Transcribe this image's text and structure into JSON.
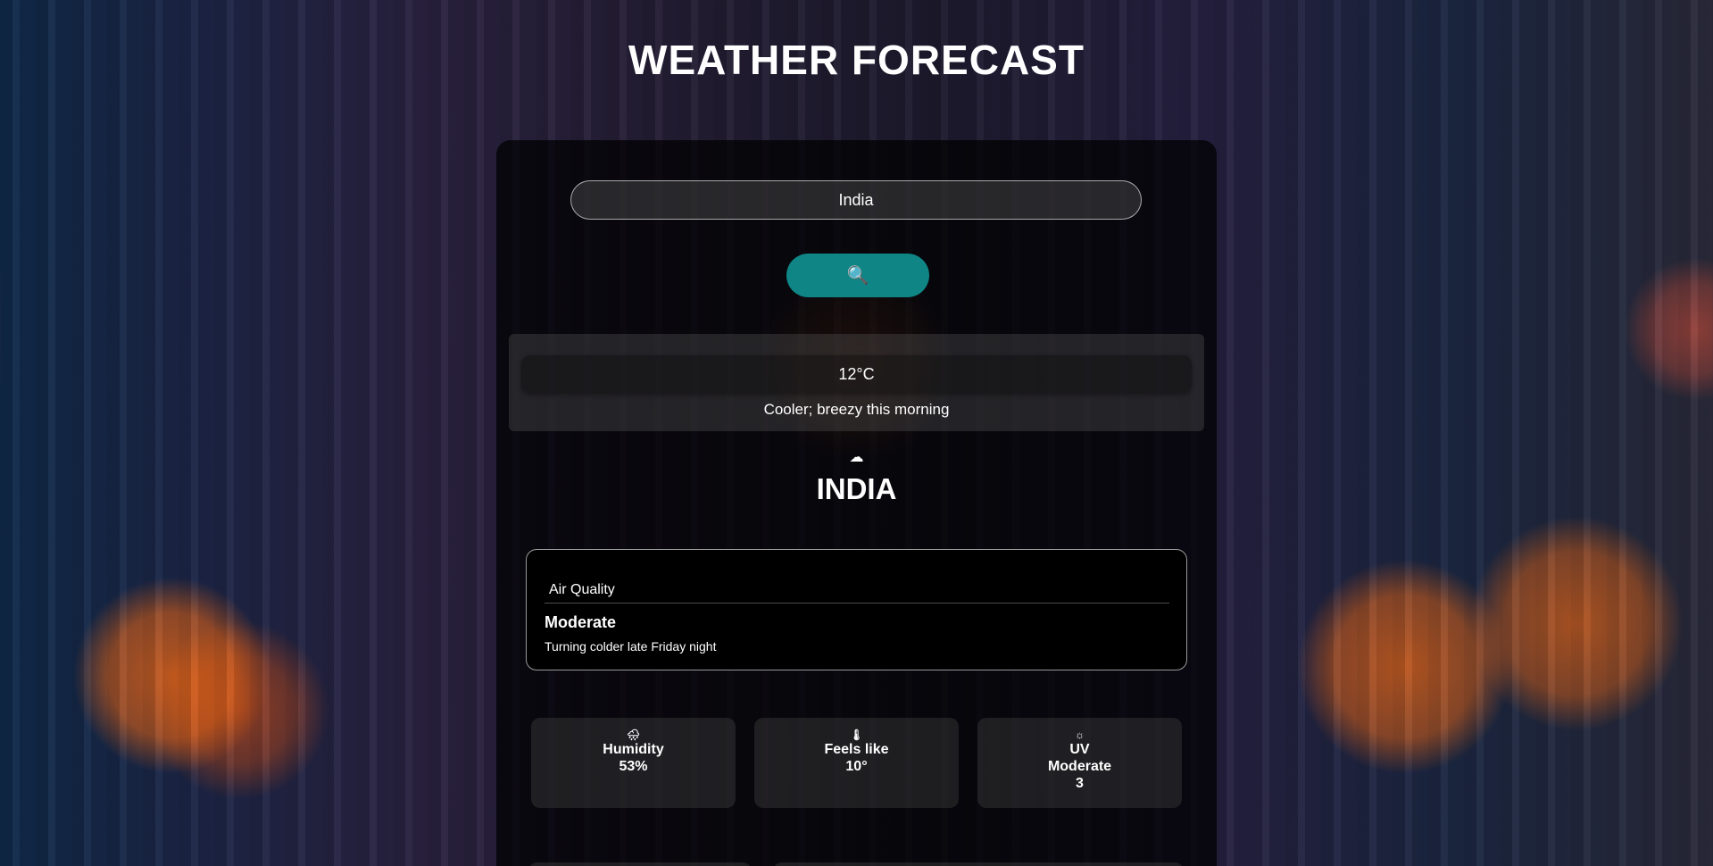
{
  "header": {
    "title": "WEATHER FORECAST"
  },
  "search": {
    "value": "India",
    "button_icon": "🔍",
    "button_icon_name": "search-icon"
  },
  "current": {
    "temperature": "12°C",
    "condition": "Cooler; breezy this morning",
    "icon": "☁",
    "icon_name": "cloud-icon",
    "city": "INDIA"
  },
  "air_quality": {
    "title": "Air Quality",
    "level": "Moderate",
    "description": "Turning colder late Friday night"
  },
  "stats": {
    "humidity": {
      "icon": "🌧",
      "icon_name": "rain-cloud-icon",
      "label": "Humidity",
      "value": "53%"
    },
    "feels_like": {
      "icon": "🌡",
      "icon_name": "thermometer-icon",
      "label": "Feels like",
      "value": "10°"
    },
    "uv": {
      "icon": "☼",
      "icon_name": "sun-icon",
      "label": "UV",
      "level": "Moderate",
      "value": "3"
    }
  },
  "colors": {
    "accent": "#0f8585",
    "card_bg": "#000000"
  }
}
